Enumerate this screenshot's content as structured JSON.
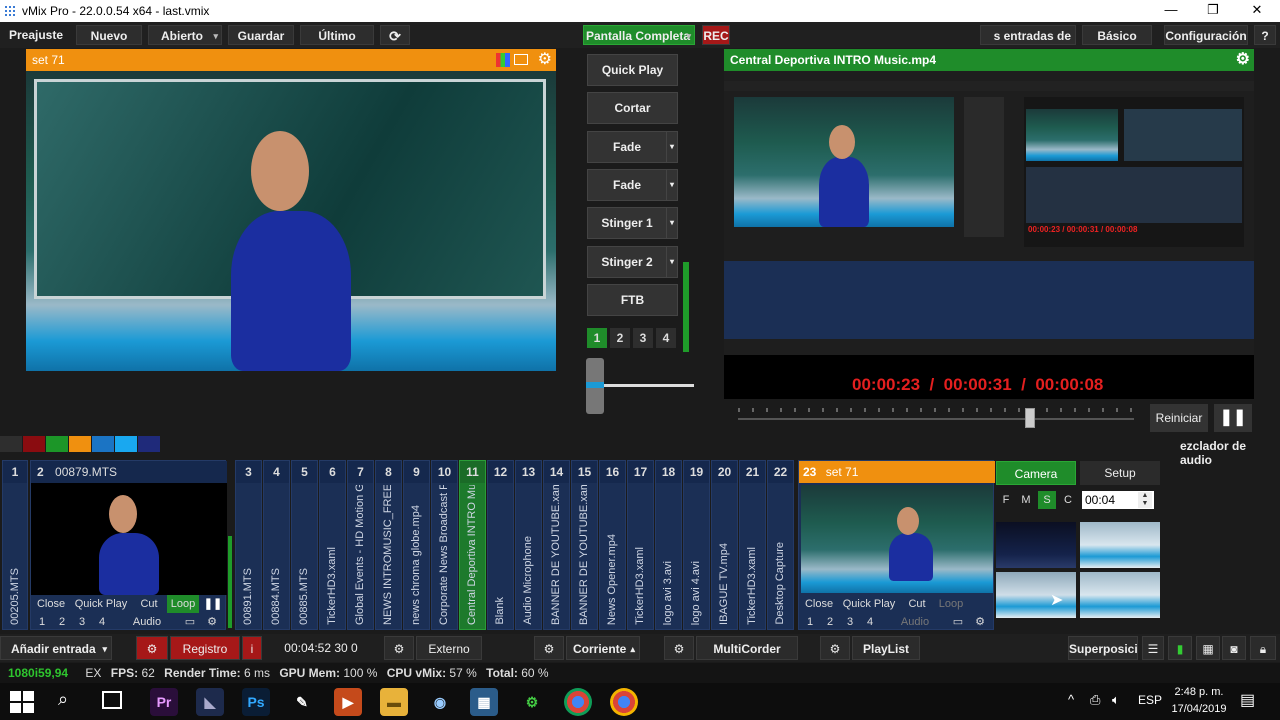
{
  "window": {
    "title": "vMix Pro - 22.0.0.54 x64 - last.vmix",
    "min": "—",
    "max": "❐",
    "close": "✕"
  },
  "menu": {
    "preset": "Preajuste",
    "new": "Nuevo",
    "open": "Abierto",
    "save": "Guardar",
    "last": "Último",
    "fullscreen": "Pantalla Completa",
    "rec": "REC",
    "inputs_cut": "s entradas de pau",
    "basic": "Básico",
    "config": "Configuración",
    "help": "?"
  },
  "preview": {
    "title": "set 71"
  },
  "transitions": {
    "quickplay": "Quick Play",
    "cut": "Cortar",
    "fade1": "Fade",
    "fade2": "Fade",
    "stinger1": "Stinger 1",
    "stinger2": "Stinger 2",
    "ftb": "FTB",
    "nums": [
      "1",
      "2",
      "3",
      "4"
    ]
  },
  "output": {
    "title": "Central Deportiva INTRO Music.mp4",
    "timecode": "00:00:23  /  00:00:31  /  00:00:08",
    "restart": "Reiniciar",
    "audio_mixer": "ezclador de audio",
    "nested_timecode": "00:00:23 / 00:00:31 / 00:00:08"
  },
  "inputs": {
    "first": {
      "num": "1",
      "vlabel": "00205.MTS"
    },
    "second": {
      "num": "2",
      "title": "00879.MTS",
      "close": "Close",
      "quickplay": "Quick Play",
      "cut": "Cut",
      "loop": "Loop",
      "nums": [
        "1",
        "2",
        "3",
        "4"
      ],
      "audio": "Audio"
    },
    "columns": [
      {
        "num": "3",
        "label": "00891.MTS"
      },
      {
        "num": "4",
        "label": "00884.MTS"
      },
      {
        "num": "5",
        "label": "00885.MTS"
      },
      {
        "num": "6",
        "label": "TickerHD3.xaml"
      },
      {
        "num": "7",
        "label": "Global Events - HD Motion Grap"
      },
      {
        "num": "8",
        "label": "NEWS INTROMUSIC_FREE.m"
      },
      {
        "num": "9",
        "label": "news chroma globe.mp4"
      },
      {
        "num": "10",
        "label": "Corporate News Broadcast Full F"
      },
      {
        "num": "11",
        "label": "Central Deportiva INTRO Music"
      },
      {
        "num": "12",
        "label": "Blank"
      },
      {
        "num": "13",
        "label": "Audio Microphone"
      },
      {
        "num": "14",
        "label": "BANNER DE YOUTUBE.xaml"
      },
      {
        "num": "15",
        "label": "BANNER DE YOUTUBE.xaml"
      },
      {
        "num": "16",
        "label": "News Opener.mp4"
      },
      {
        "num": "17",
        "label": "TickerHD3.xaml"
      },
      {
        "num": "18",
        "label": "logo avi 3.avi"
      },
      {
        "num": "19",
        "label": "logo avi 4.avi"
      },
      {
        "num": "20",
        "label": "IBAGUE TV.mp4"
      },
      {
        "num": "21",
        "label": "TickerHD3.xaml"
      },
      {
        "num": "22",
        "label": "Desktop Capture"
      }
    ],
    "last": {
      "num": "23",
      "title": "set 71",
      "close": "Close",
      "quickplay": "Quick Play",
      "cut": "Cut",
      "loop": "Loop",
      "nums": [
        "1",
        "2",
        "3",
        "4"
      ],
      "audio": "Audio"
    }
  },
  "camera_panel": {
    "camera": "Camera",
    "setup": "Setup",
    "f": "F",
    "m": "M",
    "s": "S",
    "c": "C",
    "time": "00:04"
  },
  "bottombar": {
    "add_input": "Añadir entrada",
    "record": "Registro",
    "rec_info": "i",
    "duration": "00:04:52 30 0",
    "external": "Externo",
    "stream": "Corriente",
    "multicorder": "MultiCorder",
    "playlist": "PlayList",
    "overlay": "Superposición"
  },
  "status": {
    "format": "1080i59,94",
    "ex": "EX",
    "fps_label": "FPS:",
    "fps": "62",
    "render_label": "Render Time:",
    "render": "6 ms",
    "gpu_label": "GPU Mem:",
    "gpu": "100 %",
    "cpu_label": "CPU vMix:",
    "cpu": "57 %",
    "total_label": "Total:",
    "total": "60 %"
  },
  "taskbar": {
    "lang": "ESP",
    "time": "2:48 p. m.",
    "date": "17/04/2019"
  },
  "colors": {
    "orange": "#f0900f",
    "green": "#1f8c2a",
    "blue": "#1b2f55",
    "red": "#a61818"
  }
}
